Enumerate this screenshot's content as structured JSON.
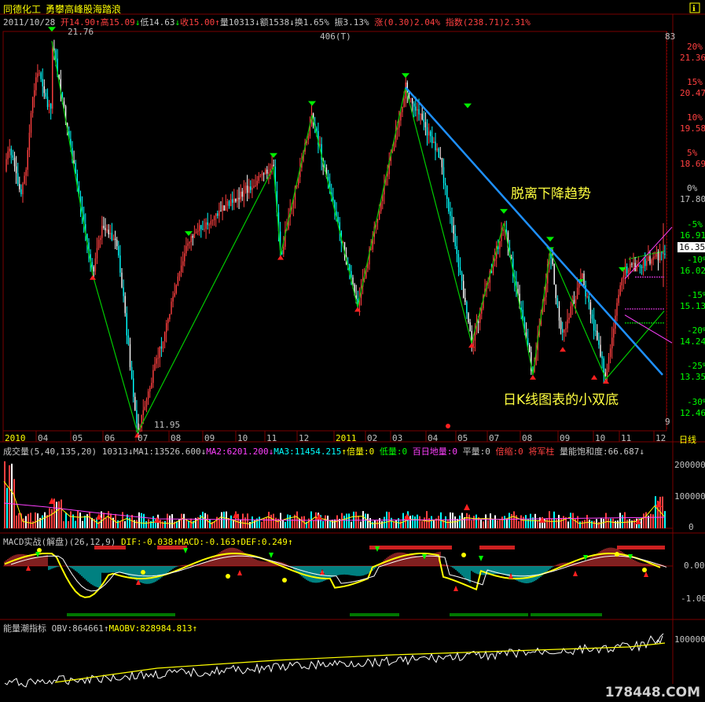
{
  "header": {
    "stock_name": "同德化工",
    "indicator_name": "勇攀高峰股海踏浪",
    "date": "2011/10/28",
    "open_label": "开",
    "open": "14.90",
    "high_label": "高",
    "high": "15.09",
    "low_label": "低",
    "low": "14.63",
    "close_label": "收",
    "close": "15.00",
    "volume_label": "量",
    "volume": "10313",
    "amount_label": "额",
    "amount": "1538",
    "turnover_label": "换",
    "turnover": "1.65%",
    "amplitude_label": "振",
    "amplitude": "3.13%",
    "change_label": "涨",
    "change": "(0.30)2.04%",
    "index_label": "指数",
    "index": "(238.71)2.31%",
    "count_label": "406(T)"
  },
  "annotations": {
    "break_trend": "脱离下降趋势",
    "double_bottom": "日K线图表的小双底",
    "peak_price": "21.76",
    "bottom_price": "11.95",
    "current_price": "16.35",
    "period_label": "日线",
    "watermark": "178448.COM",
    "top_right_num": "83",
    "bottom_right_num": "9"
  },
  "price_axis": {
    "prices": [
      "21.36",
      "20.47",
      "19.58",
      "18.69",
      "17.80",
      "16.91",
      "16.02",
      "15.13",
      "14.24",
      "13.35",
      "12.46"
    ],
    "pcts": [
      "20%",
      "15%",
      "10%",
      "5%",
      "0%",
      "-5%",
      "-10%",
      "-15%",
      "-20%",
      "-25%",
      "-30%"
    ]
  },
  "time_axis": [
    "2010",
    "04",
    "05",
    "06",
    "07",
    "08",
    "09",
    "10",
    "11",
    "12",
    "2011",
    "02",
    "03",
    "04",
    "05",
    "07",
    "08",
    "09",
    "10",
    "11",
    "12"
  ],
  "volume_panel": {
    "title": "成交量",
    "params": "(5,40,135,20)",
    "value": "10313",
    "ma1": "MA1:13526.600",
    "ma2": "MA2:6201.200",
    "ma3": "MA3:11454.215",
    "beiliang": "倍量:0",
    "diliang": "低量:0",
    "bairi": "百日地量:0",
    "pingliang": "平量:0",
    "beisuo": "倍缩:0",
    "jiangjun": "将军柱",
    "baohe": "量能饱和度:66.687",
    "axis": [
      "200000",
      "100000",
      "0"
    ]
  },
  "macd_panel": {
    "title": "MACD实战(解盘)",
    "params": "(26,12,9)",
    "dif": "DIF:-0.038",
    "macd": "MACD:-0.163",
    "dea": "DEF:0.249",
    "axis": [
      "0.00",
      "-1.00"
    ]
  },
  "obv_panel": {
    "title": "能量潮指标",
    "obv": "OBV:864661",
    "maobv": "MAOBV:828984.813",
    "axis": [
      "100000"
    ]
  },
  "chart_data": {
    "type": "candlestick",
    "y_axis_price_range": [
      12.0,
      22.0
    ],
    "swing_points": [
      {
        "date": "2010-04",
        "price": 21.76,
        "kind": "high"
      },
      {
        "date": "2010-05",
        "price": 15.9,
        "kind": "low"
      },
      {
        "date": "2010-07",
        "price": 11.95,
        "kind": "low"
      },
      {
        "date": "2010-11",
        "price": 18.6,
        "kind": "high"
      },
      {
        "date": "2010-12",
        "price": 16.4,
        "kind": "low"
      },
      {
        "date": "2010-12",
        "price": 19.9,
        "kind": "high"
      },
      {
        "date": "2011-01",
        "price": 15.1,
        "kind": "low"
      },
      {
        "date": "2011-03",
        "price": 20.6,
        "kind": "high"
      },
      {
        "date": "2011-05",
        "price": 14.2,
        "kind": "low"
      },
      {
        "date": "2011-07",
        "price": 17.2,
        "kind": "high"
      },
      {
        "date": "2011-08",
        "price": 13.4,
        "kind": "low"
      },
      {
        "date": "2011-09",
        "price": 16.5,
        "kind": "high"
      },
      {
        "date": "2011-10",
        "price": 13.3,
        "kind": "low"
      },
      {
        "date": "2011-10-28",
        "price": 15.0,
        "kind": "close"
      }
    ],
    "current_price": 16.35
  },
  "colors": {
    "up": "#ff4040",
    "down": "#00ffff",
    "zigzag": "#00cc00",
    "trend": "#1e90ff",
    "grid": "#7a0000",
    "bg": "#000000"
  }
}
